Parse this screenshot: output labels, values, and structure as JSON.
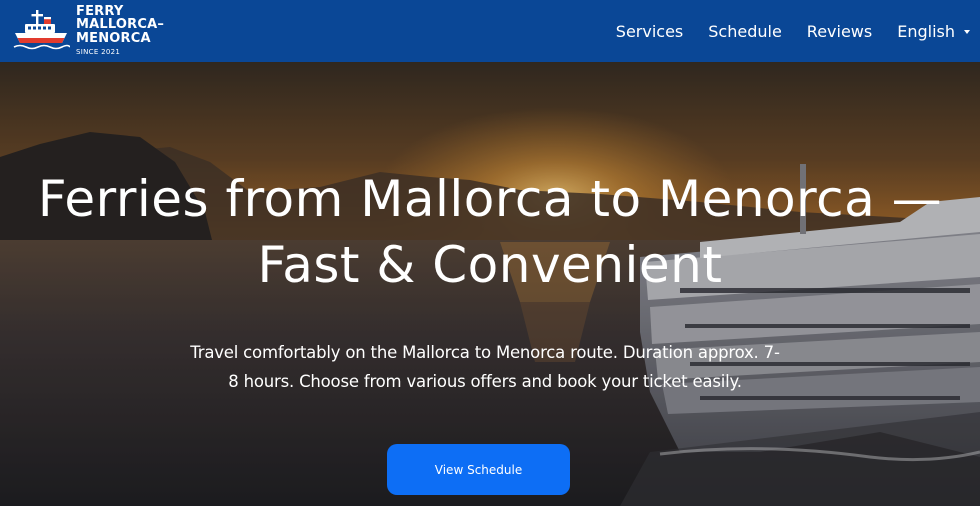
{
  "header": {
    "brand": {
      "line1": "FERRY",
      "line2": "MALLORCA–",
      "line3": "MENORCA",
      "since": "SINCE 2021",
      "icon": "ship-icon"
    },
    "nav": [
      {
        "label": "Services"
      },
      {
        "label": "Schedule"
      },
      {
        "label": "Reviews"
      }
    ],
    "language": {
      "label": "English",
      "icon": "chevron-down-icon"
    }
  },
  "hero": {
    "title_line1": "Ferries from Mallorca to Menorca —",
    "title_line2": "Fast & Convenient",
    "subtitle_line1": "Travel comfortably on the Mallorca to Menorca route. Duration approx. 7-",
    "subtitle_line2": "8 hours. Choose from various offers and book your ticket easily.",
    "cta_label": "View Schedule"
  },
  "colors": {
    "header_bg": "#0a4796",
    "cta_bg": "#0d6ef5",
    "text": "#ffffff"
  }
}
